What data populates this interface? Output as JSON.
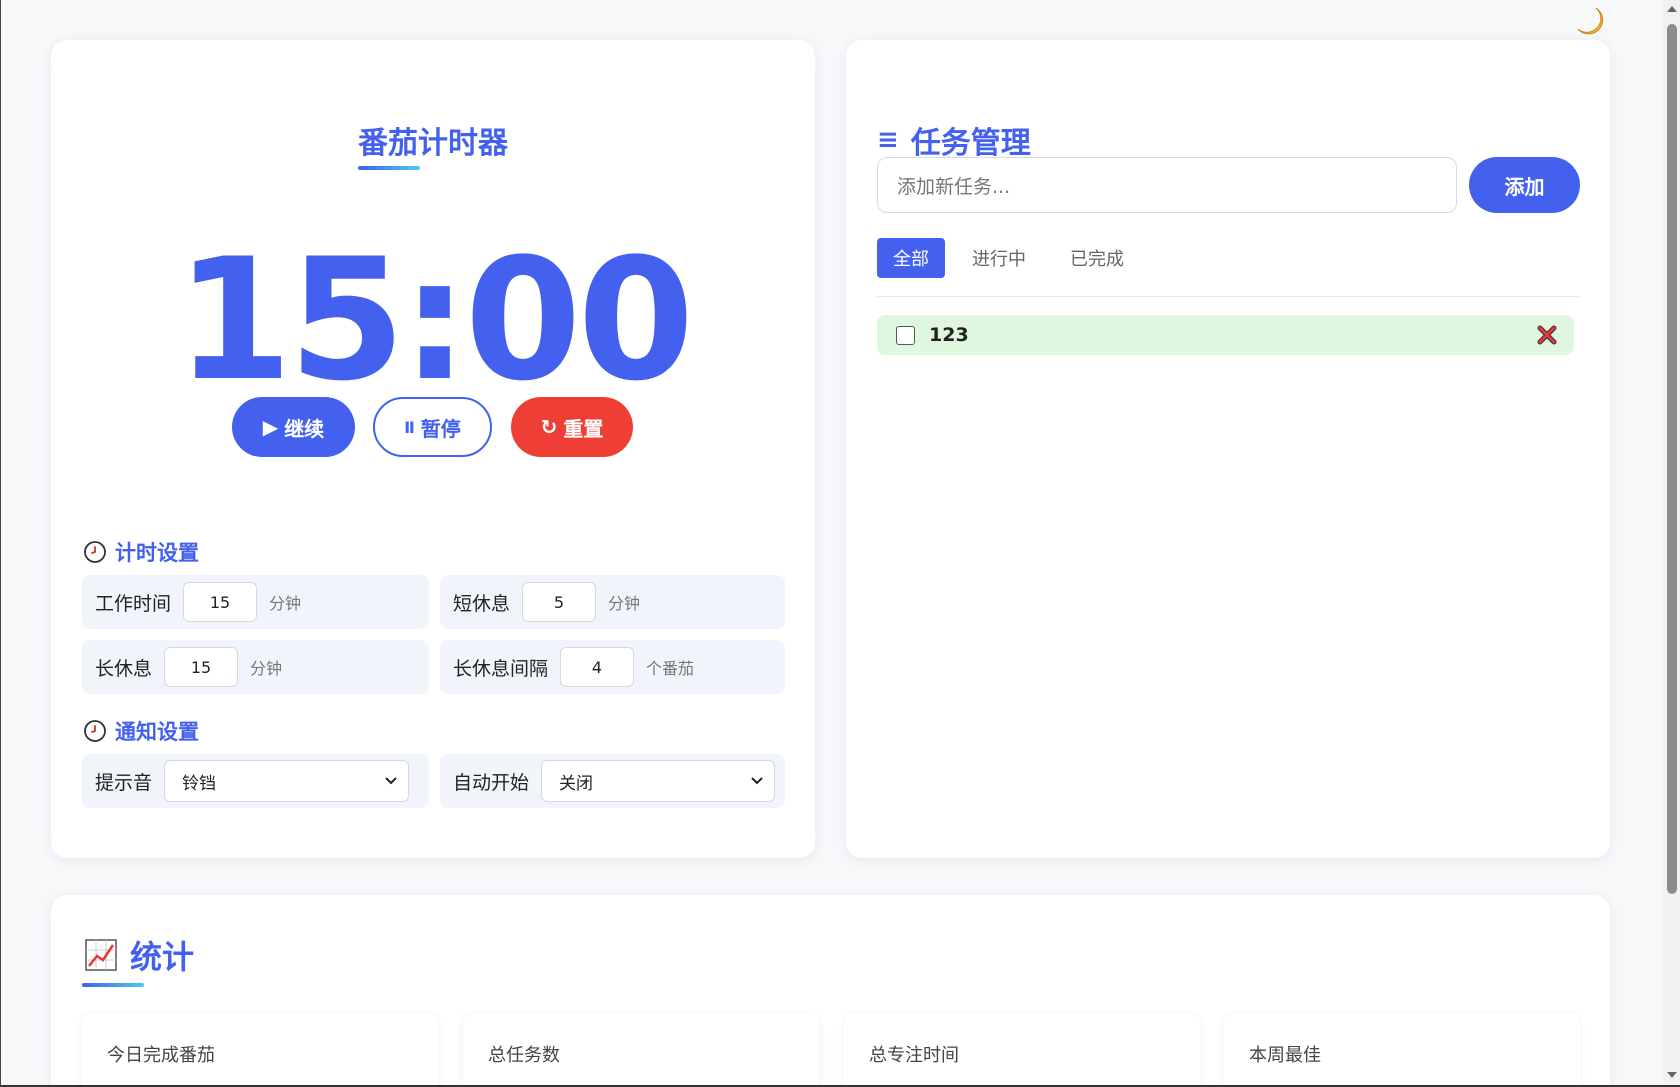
{
  "theme_toggle": {
    "icon": "moon-icon"
  },
  "timer": {
    "title": "番茄计时器",
    "display": "15:00",
    "buttons": {
      "continue_icon": "▶",
      "continue_label": "继续",
      "pause_icon": "Ⅱ",
      "pause_label": "暂停",
      "reset_icon": "↻",
      "reset_label": "重置"
    },
    "timing_settings": {
      "title": "计时设置",
      "work": {
        "label": "工作时间",
        "value": "15",
        "unit": "分钟"
      },
      "short_break": {
        "label": "短休息",
        "value": "5",
        "unit": "分钟"
      },
      "long_break": {
        "label": "长休息",
        "value": "15",
        "unit": "分钟"
      },
      "long_break_interval": {
        "label": "长休息间隔",
        "value": "4",
        "unit": "个番茄"
      }
    },
    "notification_settings": {
      "title": "通知设置",
      "sound": {
        "label": "提示音",
        "value": "铃铛"
      },
      "auto_start": {
        "label": "自动开始",
        "value": "关闭"
      }
    }
  },
  "tasks": {
    "title": "任务管理",
    "title_icon": "≡",
    "input_placeholder": "添加新任务...",
    "add_label": "添加",
    "filters": [
      "全部",
      "进行中",
      "已完成"
    ],
    "active_filter": "全部",
    "items": [
      {
        "text": "123",
        "done": false
      }
    ]
  },
  "stats": {
    "title": "统计",
    "cards": [
      "今日完成番茄",
      "总任务数",
      "总专注时间",
      "本周最佳"
    ]
  },
  "colors": {
    "accent": "#4361ee",
    "danger": "#ef3e36",
    "task_bg": "#dff7df"
  }
}
